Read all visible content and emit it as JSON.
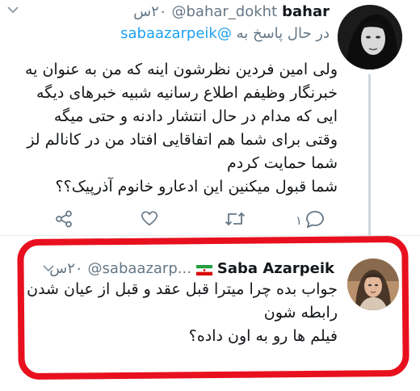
{
  "tweet1": {
    "author_name": "bahar",
    "author_handle": "@bahar_dokht",
    "time": "۲۰س",
    "reply_prefix": "در حال پاسخ به",
    "reply_to": "@sabaazarpeik",
    "lines": [
      "ولی امین فردین نظرشون اینه که من به عنوان یه",
      "خبرنگار وظیفم اطلاع رسانیه شبیه خبرهای دیگه",
      "ایی که مدام در حال انتشار دادنه و حتی میگه",
      "وقتی برای شما هم اتفاقایی افتاد من در کانالم لز",
      "شما حمایت کردم",
      "شما قبول میکنین این ادعارو خانوم آذرپیک؟؟"
    ],
    "reply_count": "۱",
    "icons": [
      "share-icon",
      "like-icon",
      "retweet-icon",
      "reply-icon",
      "chevron-down-icon"
    ]
  },
  "tweet2": {
    "author_name": "Saba Azarpeik",
    "author_handle": "@sabaazarp...",
    "time": "۲۰س",
    "flag_colors": [
      "#239f40",
      "#ffffff",
      "#da0000"
    ],
    "lines": [
      "جواب بده چرا میترا قبل عقد و قبل از عیان شدن",
      "رابطه شون",
      "فیلم ها رو به اون داده؟"
    ],
    "icons": [
      "chevron-down-icon",
      "iran-flag-icon"
    ]
  },
  "colors": {
    "highlight": "#e8101e",
    "link": "#1da1f2",
    "muted": "#657786"
  }
}
